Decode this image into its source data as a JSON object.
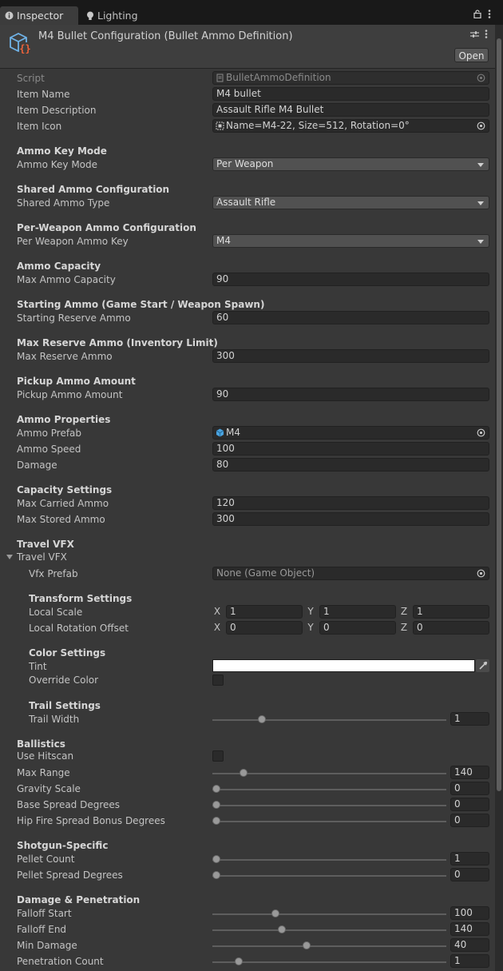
{
  "tabs": [
    {
      "label": "Inspector",
      "icon": "info-icon"
    },
    {
      "label": "Lighting",
      "icon": "lightbulb-icon"
    }
  ],
  "header": {
    "title": "M4 Bullet Configuration (Bullet Ammo Definition)",
    "open_label": "Open",
    "icon": "scriptable-object-icon"
  },
  "fields": {
    "script": {
      "label": "Script",
      "value": "BulletAmmoDefinition"
    },
    "item_name": {
      "label": "Item Name",
      "value": "M4 bullet"
    },
    "item_description": {
      "label": "Item Description",
      "value": "Assault Rifle M4 Bullet"
    },
    "item_icon": {
      "label": "Item Icon",
      "value": "Name=M4-22, Size=512, Rotation=0°"
    }
  },
  "sections": {
    "ammo_key_mode": {
      "header": "Ammo Key Mode",
      "label": "Ammo Key Mode",
      "value": "Per Weapon"
    },
    "shared_ammo": {
      "header": "Shared Ammo Configuration",
      "label": "Shared Ammo Type",
      "value": "Assault Rifle"
    },
    "per_weapon": {
      "header": "Per-Weapon Ammo Configuration",
      "label": "Per Weapon Ammo Key",
      "value": "M4"
    },
    "capacity": {
      "header": "Ammo Capacity",
      "label": "Max Ammo Capacity",
      "value": "90"
    },
    "starting": {
      "header": "Starting Ammo (Game Start / Weapon Spawn)",
      "label": "Starting Reserve Ammo",
      "value": "60"
    },
    "max_reserve": {
      "header": "Max Reserve Ammo (Inventory Limit)",
      "label": "Max Reserve Ammo",
      "value": "300"
    },
    "pickup": {
      "header": "Pickup Ammo Amount",
      "label": "Pickup Ammo Amount",
      "value": "90"
    },
    "properties": {
      "header": "Ammo Properties",
      "prefab_label": "Ammo Prefab",
      "prefab_value": "M4",
      "speed_label": "Ammo Speed",
      "speed_value": "100",
      "damage_label": "Damage",
      "damage_value": "80"
    },
    "capacity_settings": {
      "header": "Capacity Settings",
      "carried_label": "Max Carried Ammo",
      "carried_value": "120",
      "stored_label": "Max Stored Ammo",
      "stored_value": "300"
    },
    "travel_vfx": {
      "header": "Travel VFX",
      "foldout": "Travel VFX",
      "prefab_label": "Vfx Prefab",
      "prefab_value": "None (Game Object)",
      "transform_header": "Transform Settings",
      "scale_label": "Local Scale",
      "scale": {
        "x": "1",
        "y": "1",
        "z": "1"
      },
      "rotation_label": "Local Rotation Offset",
      "rotation": {
        "x": "0",
        "y": "0",
        "z": "0"
      },
      "color_header": "Color Settings",
      "tint_label": "Tint",
      "tint_color": "#ffffff",
      "override_label": "Override Color",
      "override_checked": false,
      "trail_header": "Trail Settings",
      "trail_width_label": "Trail Width",
      "trail_width_value": "1",
      "trail_width_fraction": 0.2
    },
    "ballistics": {
      "header": "Ballistics",
      "hitscan_label": "Use Hitscan",
      "hitscan_checked": false,
      "sliders": [
        {
          "label": "Max Range",
          "value": "140",
          "fraction": 0.12
        },
        {
          "label": "Gravity Scale",
          "value": "0",
          "fraction": 0.0
        },
        {
          "label": "Base Spread Degrees",
          "value": "0",
          "fraction": 0.0
        },
        {
          "label": "Hip Fire Spread Bonus Degrees",
          "value": "0",
          "fraction": 0.0
        }
      ]
    },
    "shotgun": {
      "header": "Shotgun-Specific",
      "sliders": [
        {
          "label": "Pellet Count",
          "value": "1",
          "fraction": 0.0
        },
        {
          "label": "Pellet Spread Degrees",
          "value": "0",
          "fraction": 0.0
        }
      ]
    },
    "damage_penetration": {
      "header": "Damage & Penetration",
      "sliders": [
        {
          "label": "Falloff Start",
          "value": "100",
          "fraction": 0.26
        },
        {
          "label": "Falloff End",
          "value": "140",
          "fraction": 0.29
        },
        {
          "label": "Min Damage",
          "value": "40",
          "fraction": 0.4
        },
        {
          "label": "Penetration Count",
          "value": "1",
          "fraction": 0.1
        }
      ]
    }
  },
  "axis_labels": {
    "x": "X",
    "y": "Y",
    "z": "Z"
  },
  "colors": {
    "background": "#383838",
    "field": "#2a2a2a",
    "tab_bar": "#191919",
    "text": "#c4c4c4"
  }
}
